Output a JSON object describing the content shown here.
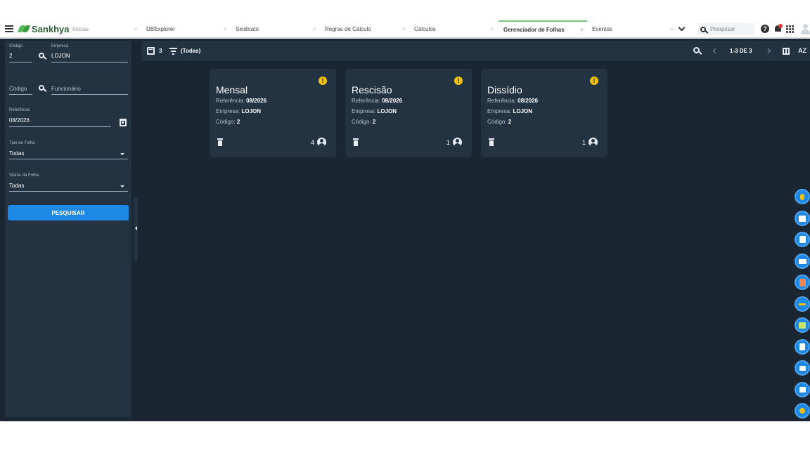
{
  "topbar": {
    "brand": "Sankhya",
    "tabs": [
      {
        "label": "ências",
        "active": false
      },
      {
        "label": "DBExplorer",
        "active": false
      },
      {
        "label": "Sindicato",
        "active": false
      },
      {
        "label": "Regras de Cálculo",
        "active": false
      },
      {
        "label": "Cálculos",
        "active": false
      },
      {
        "label": "Gerenciador de Folhas",
        "active": true
      },
      {
        "label": "Eventos",
        "active": false
      }
    ],
    "search_placeholder": "Pesquisar",
    "help": "?",
    "close": "×"
  },
  "filters": {
    "codigo_label": "Código",
    "codigo_value": "2",
    "empresa_label": "Empresa",
    "empresa_value": "LOJON",
    "funcionario_codigo_placeholder": "Código",
    "funcionario_placeholder": "Funcionário",
    "referencia_label": "Referência",
    "referencia_value": "08/2026",
    "tipo_label": "Tipo de Folha",
    "tipo_value": "Todas",
    "status_label": "Status da Folha",
    "status_value": "Todas",
    "search_button": "PESQUISAR"
  },
  "toolbar": {
    "count": "3",
    "filter_text": "(Todas)",
    "pagination": "1-3 DE 3",
    "sort_label": "AZ"
  },
  "cards": [
    {
      "title": "Mensal",
      "ref_label": "Referência:",
      "ref_value": "08/2026",
      "emp_label": "Empresa:",
      "emp_value": "LOJON",
      "cod_label": "Código:",
      "cod_value": "2",
      "count": "4",
      "warn": "!"
    },
    {
      "title": "Rescisão",
      "ref_label": "Referência:",
      "ref_value": "08/2026",
      "emp_label": "Empresa:",
      "emp_value": "LOJON",
      "cod_label": "Código:",
      "cod_value": "2",
      "count": "1",
      "warn": "!"
    },
    {
      "title": "Dissídio",
      "ref_label": "Referência:",
      "ref_value": "08/2026",
      "emp_label": "Empresa:",
      "emp_value": "LOJON",
      "cod_label": "Código:",
      "cod_value": "2",
      "count": "1",
      "warn": "!"
    }
  ],
  "colors": {
    "app_bg": "#1a2733",
    "panel_bg": "#233342",
    "accent": "#1e88e5",
    "warning": "#f4c20d",
    "brand_green": "#3a9c3e"
  }
}
